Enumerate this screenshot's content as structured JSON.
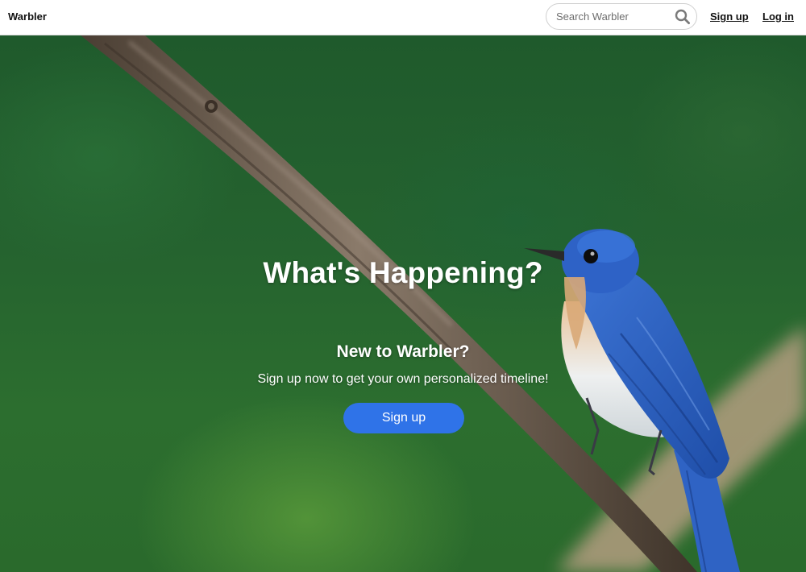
{
  "navbar": {
    "brand": "Warbler",
    "search_placeholder": "Search Warbler",
    "search_value": "",
    "signup_label": "Sign up",
    "login_label": "Log in"
  },
  "hero": {
    "title": "What's Happening?",
    "subtitle": "New to Warbler?",
    "text": "Sign up now to get your own personalized timeline!",
    "signup_button_label": "Sign up",
    "background_image": "blue-flycatcher-on-branch"
  },
  "icons": {
    "search": "search-icon"
  },
  "colors": {
    "primary_button": "#2f73e8",
    "navbar_bg": "#ffffff",
    "hero_text": "#ffffff",
    "background_green": "#25632f",
    "bird_blue": "#2a5fc0"
  }
}
